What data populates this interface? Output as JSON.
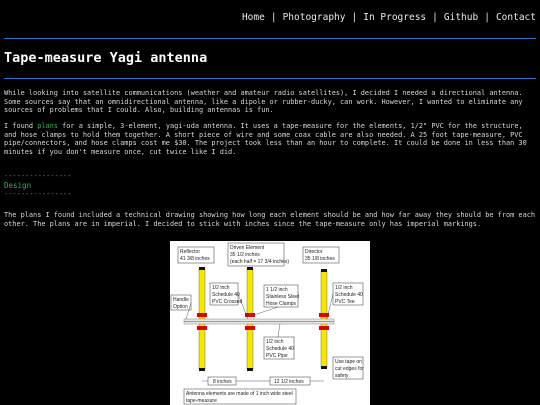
{
  "nav": {
    "items": [
      "Home",
      "Photography",
      "In Progress",
      "Github",
      "Contact"
    ],
    "separator": "|"
  },
  "article": {
    "title": "Tape-measure Yagi antenna",
    "p1": "While looking into satellite communications (weather and amateur radio satellites), I decided I needed a directional antenna. Some sources say that an omnidirectional antenna, like a dipole or rubber-ducky, can work. However, I wanted to eliminate any sources of problems that I could. Also, building antennas is fun.",
    "p2_prefix": "I found ",
    "p2_link": "plans",
    "p2_suffix": " for a simple, 3-element, yagi-uda antenna. It uses a tape-measure for the elements, 1/2\" PVC for the structure, and hose clamps to hold them together. A short piece of wire and some coax cable are also needed. A 25 foot tape-measure, PVC pipe/connectors, and hose clamps cost me $30. The project took less than an hour to complete. It could be done in less than 30 minutes if you don't measure once, cut twice like I did.",
    "divider": "----------------",
    "section_title": "Design",
    "p3": "The plans I found included a technical drawing showing how long each element should be and how far away they should be from each other. The plans are in imperial. I decided to stick with inches since the tape-measure only has imperial markings."
  },
  "diagram": {
    "reflector": [
      "Reflector",
      "41  3/8 inches"
    ],
    "driven": [
      "Driven Element",
      "35  1/2 inches",
      "(each half = 17 3/4 inches)"
    ],
    "director": [
      "Director",
      "35  1/8 inches"
    ],
    "pvc_crossed": [
      "1/2 inch",
      "Schedule 40",
      "PVC Crossed"
    ],
    "clamps": [
      "1  1/2 inch",
      "Stainless Steel",
      "Hose Clamps"
    ],
    "pvc_tee": [
      "1/2 inch",
      "Schedule 40",
      "PVC Tee"
    ],
    "handle": [
      "Handle",
      "Option"
    ],
    "pipe": [
      "1/2 inch",
      "Schedule 40",
      "PVC Pipe"
    ],
    "tape_tip": [
      "Use tape on",
      "cut edges for",
      "safety"
    ],
    "dim1": "8  inches",
    "dim2": "12  1/2  inches",
    "footer": [
      "Antenna elements are made of 1 inch wide steel",
      "tape-measure"
    ]
  }
}
